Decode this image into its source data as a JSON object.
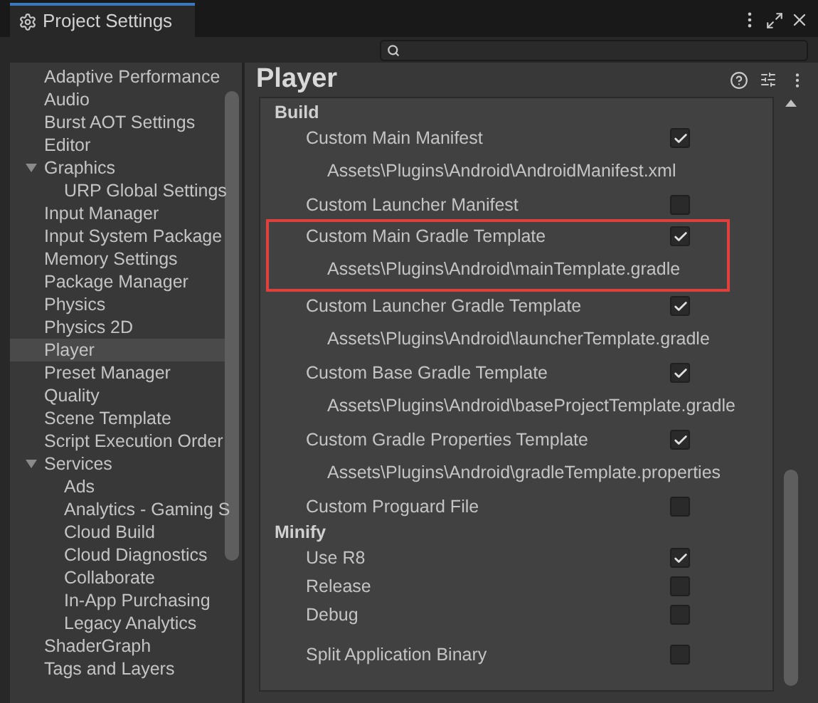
{
  "window": {
    "title": "Project Settings"
  },
  "sidebar": {
    "items": [
      {
        "label": "Adaptive Performance",
        "selected": false
      },
      {
        "label": "Audio",
        "selected": false
      },
      {
        "label": "Burst AOT Settings",
        "selected": false
      },
      {
        "label": "Editor",
        "selected": false
      },
      {
        "label": "Graphics",
        "selected": false,
        "expanded": true,
        "children": [
          {
            "label": "URP Global Settings",
            "selected": false
          }
        ]
      },
      {
        "label": "Input Manager",
        "selected": false
      },
      {
        "label": "Input System Package",
        "selected": false
      },
      {
        "label": "Memory Settings",
        "selected": false
      },
      {
        "label": "Package Manager",
        "selected": false
      },
      {
        "label": "Physics",
        "selected": false
      },
      {
        "label": "Physics 2D",
        "selected": false
      },
      {
        "label": "Player",
        "selected": true
      },
      {
        "label": "Preset Manager",
        "selected": false
      },
      {
        "label": "Quality",
        "selected": false
      },
      {
        "label": "Scene Template",
        "selected": false
      },
      {
        "label": "Script Execution Order",
        "selected": false
      },
      {
        "label": "Services",
        "selected": false,
        "expanded": true,
        "children": [
          {
            "label": "Ads",
            "selected": false
          },
          {
            "label": "Analytics - Gaming S",
            "selected": false
          },
          {
            "label": "Cloud Build",
            "selected": false
          },
          {
            "label": "Cloud Diagnostics",
            "selected": false
          },
          {
            "label": "Collaborate",
            "selected": false
          },
          {
            "label": "In-App Purchasing",
            "selected": false
          },
          {
            "label": "Legacy Analytics",
            "selected": false
          }
        ]
      },
      {
        "label": "ShaderGraph",
        "selected": false
      },
      {
        "label": "Tags and Layers",
        "selected": false
      }
    ]
  },
  "panel": {
    "title": "Player",
    "sections": [
      {
        "title": "Build",
        "rows": [
          {
            "label": "Custom Main Manifest",
            "checked": true,
            "highlighted": false,
            "path": "Assets\\Plugins\\Android\\AndroidManifest.xml"
          },
          {
            "label": "Custom Launcher Manifest",
            "checked": false,
            "highlighted": false
          },
          {
            "label": "Custom Main Gradle Template",
            "checked": true,
            "highlighted": true,
            "path": "Assets\\Plugins\\Android\\mainTemplate.gradle"
          },
          {
            "label": "Custom Launcher Gradle Template",
            "checked": true,
            "highlighted": false,
            "path": "Assets\\Plugins\\Android\\launcherTemplate.gradle"
          },
          {
            "label": "Custom Base Gradle Template",
            "checked": true,
            "highlighted": false,
            "path": "Assets\\Plugins\\Android\\baseProjectTemplate.gradle"
          },
          {
            "label": "Custom Gradle Properties Template",
            "checked": true,
            "highlighted": false,
            "path": "Assets\\Plugins\\Android\\gradleTemplate.properties"
          },
          {
            "label": "Custom Proguard File",
            "checked": false,
            "highlighted": false
          }
        ]
      },
      {
        "title": "Minify",
        "rows": [
          {
            "label": "Use R8",
            "checked": true,
            "highlighted": false
          },
          {
            "label": "Release",
            "checked": false,
            "highlighted": false
          },
          {
            "label": "Debug",
            "checked": false,
            "highlighted": false
          }
        ]
      },
      {
        "rows": [
          {
            "label": "Split Application Binary",
            "checked": false,
            "highlighted": false
          }
        ]
      }
    ]
  }
}
